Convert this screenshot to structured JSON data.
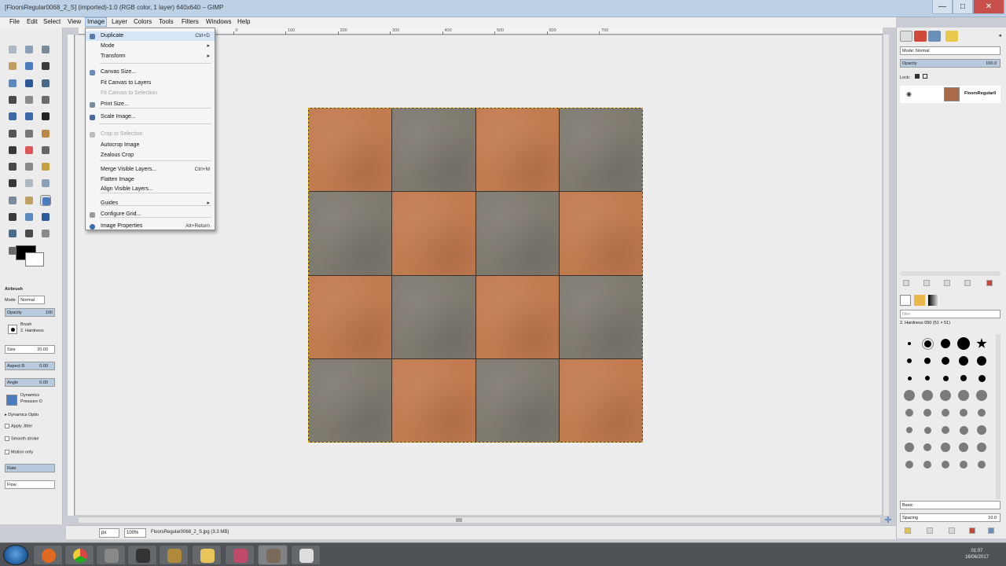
{
  "window": {
    "title": "[FloorsRegular0068_2_S] (imported)-1.0 (RGB color, 1 layer) 640x640 – GIMP",
    "min_label": "—",
    "max_label": "□",
    "close_label": "✕"
  },
  "menubar": [
    "File",
    "Edit",
    "Select",
    "View",
    "Image",
    "Layer",
    "Colors",
    "Tools",
    "Filters",
    "Windows",
    "Help"
  ],
  "ruler": {
    "ticks": [
      "-100",
      "0",
      "100",
      "200",
      "300",
      "400",
      "500",
      "600",
      "700"
    ]
  },
  "image_menu": {
    "items": [
      {
        "label": "Duplicate",
        "shortcut": "Ctrl+D",
        "icon": "duplicate-icon",
        "enabled": true
      },
      {
        "label": "Mode",
        "submenu": true,
        "enabled": true
      },
      {
        "label": "Transform",
        "submenu": true,
        "enabled": true
      },
      {
        "label": "Canvas Size...",
        "icon": "canvas-size-icon",
        "enabled": true
      },
      {
        "label": "Fit Canvas to Layers",
        "enabled": true
      },
      {
        "label": "Fit Canvas to Selection",
        "enabled": false
      },
      {
        "label": "Print Size...",
        "icon": "print-size-icon",
        "enabled": true
      },
      {
        "label": "Scale Image...",
        "icon": "scale-image-icon",
        "enabled": true
      },
      {
        "label": "Crop to Selection",
        "icon": "crop-icon",
        "enabled": false
      },
      {
        "label": "Autocrop Image",
        "enabled": true
      },
      {
        "label": "Zealous Crop",
        "enabled": true
      },
      {
        "label": "Merge Visible Layers...",
        "shortcut": "Ctrl+M",
        "enabled": true
      },
      {
        "label": "Flatten Image",
        "enabled": true
      },
      {
        "label": "Align Visible Layers...",
        "enabled": true
      },
      {
        "label": "Guides",
        "submenu": true,
        "enabled": true
      },
      {
        "label": "Configure Grid...",
        "icon": "grid-icon",
        "enabled": true
      },
      {
        "label": "Image Properties",
        "shortcut": "Alt+Return",
        "icon": "info-icon",
        "enabled": true
      }
    ]
  },
  "tool_options": {
    "tool_name": "Airbrush",
    "mode_label": "Mode",
    "mode_value": "Normal",
    "opacity_label": "Opacity",
    "opacity_value": "100",
    "brush_label": "Brush",
    "brush_value": "2. Hardness",
    "size_label": "Size",
    "size_value": "20.00",
    "aspect_label": "Aspect R",
    "aspect_value": "0.00",
    "angle_label": "Angle",
    "angle_value": "0.00",
    "dynamics_label": "Dynamics",
    "dynamics_value": "Pressure O",
    "dynamics_options": "Dynamics Optio",
    "apply_jitter": "Apply Jitter",
    "smooth_stroke": "Smooth stroke",
    "motion_only": "Motion only",
    "rate_label": "Rate",
    "flow_label": "Flow"
  },
  "layers": {
    "mode_label": "Mode: Normal",
    "opacity_label": "Opacity",
    "opacity_value": "100.0",
    "lock_label": "Lock:",
    "layer_name": "FloorsRegular0"
  },
  "brushes": {
    "filter_placeholder": "filter",
    "selected_brush": "2. Hardness 050 (51 × 51)",
    "preset_label": "Basic",
    "spacing_label": "Spacing",
    "spacing_value": "10.0"
  },
  "statusbar": {
    "unit": "px",
    "zoom": "100%",
    "message": "FloorsRegular0068_2_S.jpg (3.3 MB)"
  },
  "tiles": [
    "o",
    "g",
    "o",
    "g",
    "g",
    "o",
    "g",
    "o",
    "o",
    "g",
    "o",
    "g",
    "g",
    "o",
    "g",
    "o"
  ],
  "colors": {
    "orange_tile": "#c27a4f",
    "gray_tile": "#7f7a70",
    "menu_highlight": "#d7e6f7"
  },
  "clock": {
    "time": "01:07",
    "date": "16/06/2017"
  }
}
